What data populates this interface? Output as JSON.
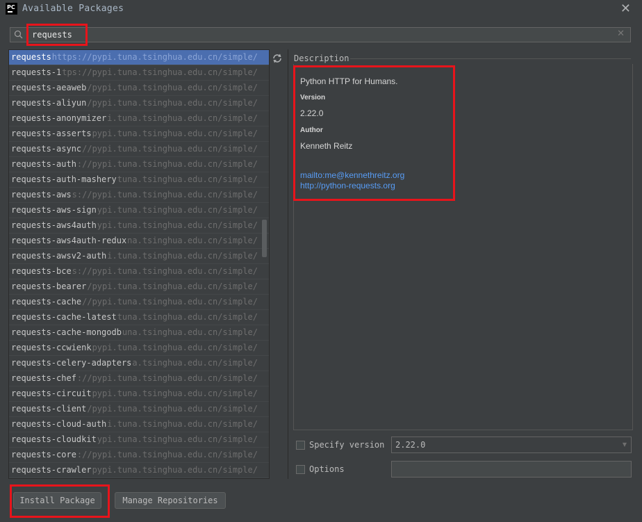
{
  "window": {
    "title": "Available Packages",
    "app_icon_text": "PC",
    "close_glyph": "✕"
  },
  "search": {
    "value": "requests",
    "clear_glyph": "✕"
  },
  "packages": [
    {
      "name": "requests",
      "repo": "https://pypi.tuna.tsinghua.edu.cn/simple/",
      "selected": true
    },
    {
      "name": "requests-1",
      "repo": "https://pypi.tuna.tsinghua.edu.cn/simple/"
    },
    {
      "name": "requests-aeaweb",
      "repo": "https://pypi.tuna.tsinghua.edu.cn/simple/"
    },
    {
      "name": "requests-aliyun",
      "repo": "https://pypi.tuna.tsinghua.edu.cn/simple/"
    },
    {
      "name": "requests-anonymizer",
      "repo": "https://pypi.tuna.tsinghua.edu.cn/simple/"
    },
    {
      "name": "requests-asserts",
      "repo": "https://pypi.tuna.tsinghua.edu.cn/simple/"
    },
    {
      "name": "requests-async",
      "repo": "https://pypi.tuna.tsinghua.edu.cn/simple/"
    },
    {
      "name": "requests-auth",
      "repo": "https://pypi.tuna.tsinghua.edu.cn/simple/"
    },
    {
      "name": "requests-auth-mashery",
      "repo": "https://pypi.tuna.tsinghua.edu.cn/simple/"
    },
    {
      "name": "requests-aws",
      "repo": "https://pypi.tuna.tsinghua.edu.cn/simple/"
    },
    {
      "name": "requests-aws-sign",
      "repo": "https://pypi.tuna.tsinghua.edu.cn/simple/"
    },
    {
      "name": "requests-aws4auth",
      "repo": "https://pypi.tuna.tsinghua.edu.cn/simple/"
    },
    {
      "name": "requests-aws4auth-redux",
      "repo": "https://pypi.tuna.tsinghua.edu.cn/simple/"
    },
    {
      "name": "requests-awsv2-auth",
      "repo": "https://pypi.tuna.tsinghua.edu.cn/simple/"
    },
    {
      "name": "requests-bce",
      "repo": "https://pypi.tuna.tsinghua.edu.cn/simple/"
    },
    {
      "name": "requests-bearer",
      "repo": "https://pypi.tuna.tsinghua.edu.cn/simple/"
    },
    {
      "name": "requests-cache",
      "repo": "https://pypi.tuna.tsinghua.edu.cn/simple/"
    },
    {
      "name": "requests-cache-latest",
      "repo": "https://pypi.tuna.tsinghua.edu.cn/simple/"
    },
    {
      "name": "requests-cache-mongodb",
      "repo": "https://pypi.tuna.tsinghua.edu.cn/simple/"
    },
    {
      "name": "requests-ccwienk",
      "repo": "https://pypi.tuna.tsinghua.edu.cn/simple/"
    },
    {
      "name": "requests-celery-adapters",
      "repo": "https://pypi.tuna.tsinghua.edu.cn/simple/"
    },
    {
      "name": "requests-chef",
      "repo": "https://pypi.tuna.tsinghua.edu.cn/simple/"
    },
    {
      "name": "requests-circuit",
      "repo": "https://pypi.tuna.tsinghua.edu.cn/simple/"
    },
    {
      "name": "requests-client",
      "repo": "https://pypi.tuna.tsinghua.edu.cn/simple/"
    },
    {
      "name": "requests-cloud-auth",
      "repo": "https://pypi.tuna.tsinghua.edu.cn/simple/"
    },
    {
      "name": "requests-cloudkit",
      "repo": "https://pypi.tuna.tsinghua.edu.cn/simple/"
    },
    {
      "name": "requests-core",
      "repo": "https://pypi.tuna.tsinghua.edu.cn/simple/"
    },
    {
      "name": "requests-crawler",
      "repo": "https://pypi.tuna.tsinghua.edu.cn/simple/"
    }
  ],
  "description": {
    "label": "Description",
    "summary": "Python HTTP for Humans.",
    "version_heading": "Version",
    "version": "2.22.0",
    "author_heading": "Author",
    "author": "Kenneth Reitz",
    "email_link": "mailto:me@kennethreitz.org",
    "homepage_link": "http://python-requests.org"
  },
  "options": {
    "specify_version_label": "Specify version",
    "specify_version_checked": false,
    "version_value": "2.22.0",
    "options_label": "Options",
    "options_checked": false,
    "options_value": ""
  },
  "buttons": {
    "install": "Install Package",
    "manage": "Manage Repositories"
  },
  "colors": {
    "background": "#3c3f41",
    "selection": "#4b6eaf",
    "link": "#589df6",
    "annotation_red": "#e8141b"
  },
  "icons": {
    "app": "pycharm-icon",
    "search": "search-icon",
    "refresh": "refresh-icon",
    "close": "close-icon",
    "dropdown": "chevron-down-icon"
  }
}
